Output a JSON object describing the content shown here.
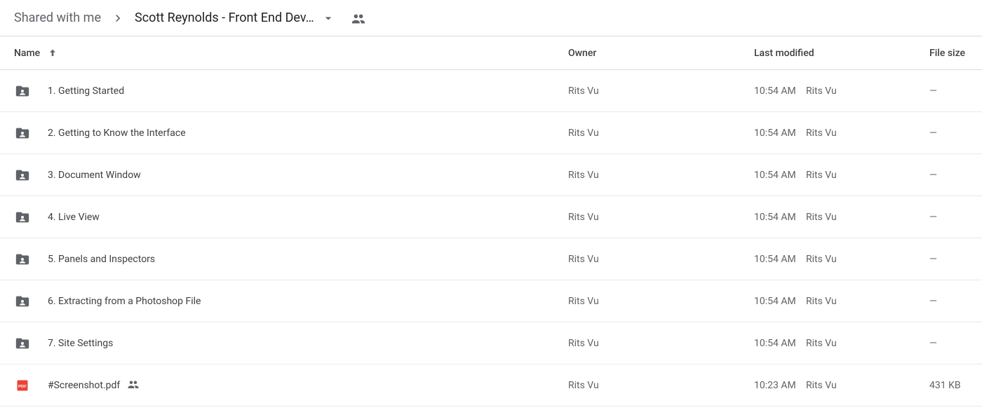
{
  "breadcrumb": {
    "root": "Shared with me",
    "current": "Scott Reynolds - Front End Dev…"
  },
  "columns": {
    "name": "Name",
    "owner": "Owner",
    "modified": "Last modified",
    "size": "File size"
  },
  "rows": [
    {
      "icon": "folder",
      "shared": false,
      "name": "1. Getting Started",
      "owner": "Rits Vu",
      "mod_time": "10:54 AM",
      "mod_by": "Rits Vu",
      "size": "—"
    },
    {
      "icon": "folder",
      "shared": false,
      "name": "2. Getting to Know the Interface",
      "owner": "Rits Vu",
      "mod_time": "10:54 AM",
      "mod_by": "Rits Vu",
      "size": "—"
    },
    {
      "icon": "folder",
      "shared": false,
      "name": "3. Document Window",
      "owner": "Rits Vu",
      "mod_time": "10:54 AM",
      "mod_by": "Rits Vu",
      "size": "—"
    },
    {
      "icon": "folder",
      "shared": false,
      "name": "4. Live View",
      "owner": "Rits Vu",
      "mod_time": "10:54 AM",
      "mod_by": "Rits Vu",
      "size": "—"
    },
    {
      "icon": "folder",
      "shared": false,
      "name": "5. Panels and Inspectors",
      "owner": "Rits Vu",
      "mod_time": "10:54 AM",
      "mod_by": "Rits Vu",
      "size": "—"
    },
    {
      "icon": "folder",
      "shared": false,
      "name": "6. Extracting from a Photoshop File",
      "owner": "Rits Vu",
      "mod_time": "10:54 AM",
      "mod_by": "Rits Vu",
      "size": "—"
    },
    {
      "icon": "folder",
      "shared": false,
      "name": "7. Site Settings",
      "owner": "Rits Vu",
      "mod_time": "10:54 AM",
      "mod_by": "Rits Vu",
      "size": "—"
    },
    {
      "icon": "pdf",
      "shared": true,
      "name": "#Screenshot.pdf",
      "owner": "Rits Vu",
      "mod_time": "10:23 AM",
      "mod_by": "Rits Vu",
      "size": "431 KB"
    }
  ]
}
